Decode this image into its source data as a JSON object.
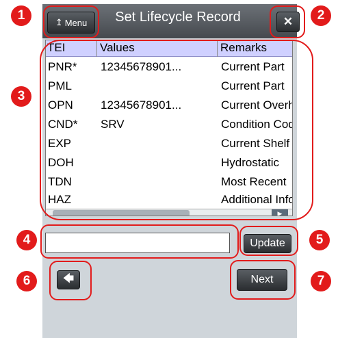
{
  "window": {
    "title": "Set Lifecycle Record"
  },
  "toolbar": {
    "menu_label": "Menu",
    "menu_icon": "↥",
    "close_icon": "✕"
  },
  "grid": {
    "columns": [
      "TEI",
      "Values",
      "Remarks"
    ],
    "rows": [
      {
        "tei": "PNR*",
        "value": "12345678901...",
        "remark": "Current Part"
      },
      {
        "tei": "PML",
        "value": "",
        "remark": "Current Part"
      },
      {
        "tei": "OPN",
        "value": "12345678901...",
        "remark": "Current Overhaul"
      },
      {
        "tei": "CND*",
        "value": "SRV",
        "remark": "Condition Code"
      },
      {
        "tei": "EXP",
        "value": "",
        "remark": "Current Shelf"
      },
      {
        "tei": "DOH",
        "value": "",
        "remark": "Hydrostatic"
      },
      {
        "tei": "TDN",
        "value": "",
        "remark": "Most Recent"
      },
      {
        "tei": "HAZ",
        "value": "",
        "remark": "Additional Info"
      }
    ]
  },
  "form": {
    "input_value": "",
    "update_label": "Update",
    "next_label": "Next",
    "back_icon": "🡄"
  },
  "callouts": [
    "1",
    "2",
    "3",
    "4",
    "5",
    "6",
    "7"
  ],
  "colors": {
    "accent": "#e21b1b",
    "header": "#cfd0ff",
    "titlebar": "#45494e",
    "frame": "#cfd5da"
  }
}
